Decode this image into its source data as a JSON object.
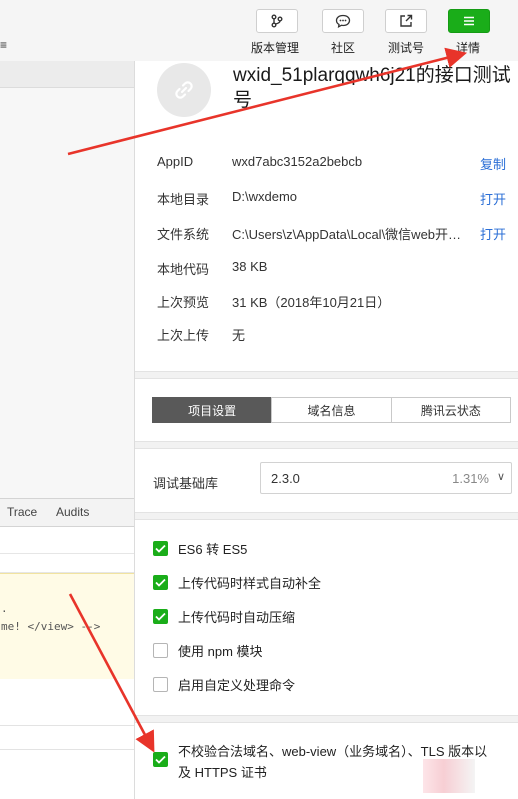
{
  "toolbar": {
    "left_fragment": "≡",
    "buttons": [
      {
        "label": "版本管理",
        "icon": "branch-icon"
      },
      {
        "label": "社区",
        "icon": "chat-icon"
      },
      {
        "label": "测试号",
        "icon": "share-icon"
      },
      {
        "label": "详情",
        "icon": "menu-icon"
      }
    ]
  },
  "devtools": {
    "tabs": [
      "Trace",
      "Audits"
    ]
  },
  "console": {
    "line1": ".",
    "line2": "me! </view> -->"
  },
  "project": {
    "name": "wxid_51plarqqwh6j21的接口测试号",
    "info": [
      {
        "label": "AppID",
        "value": "wxd7abc3152a2bebcb",
        "action": "复制"
      },
      {
        "label": "本地目录",
        "value": "D:\\wxdemo",
        "action": "打开"
      },
      {
        "label": "文件系统",
        "value": "C:\\Users\\z\\AppData\\Local\\微信web开发者工具\\User Data",
        "action": "打开"
      },
      {
        "label": "本地代码",
        "value": "38 KB",
        "action": ""
      },
      {
        "label": "上次预览",
        "value": "31 KB（2018年10月21日）",
        "action": ""
      },
      {
        "label": "上次上传",
        "value": "无",
        "action": ""
      }
    ]
  },
  "tabs": [
    "项目设置",
    "域名信息",
    "腾讯云状态"
  ],
  "library": {
    "label": "调试基础库",
    "version": "2.3.0",
    "usage": "1.31%"
  },
  "options": [
    {
      "label": "ES6 转 ES5",
      "checked": true
    },
    {
      "label": "上传代码时样式自动补全",
      "checked": true
    },
    {
      "label": "上传代码时自动压缩",
      "checked": true
    },
    {
      "label": "使用 npm 模块",
      "checked": false
    },
    {
      "label": "启用自定义处理命令",
      "checked": false
    }
  ],
  "domain_option": {
    "label": "不校验合法域名、web-view（业务域名）、TLS 版本以及 HTTPS 证书",
    "checked": true
  },
  "colors": {
    "accent": "#1aad19",
    "link": "#2a6ed6",
    "arrow": "#e8342a",
    "active_tab": "#595959"
  }
}
